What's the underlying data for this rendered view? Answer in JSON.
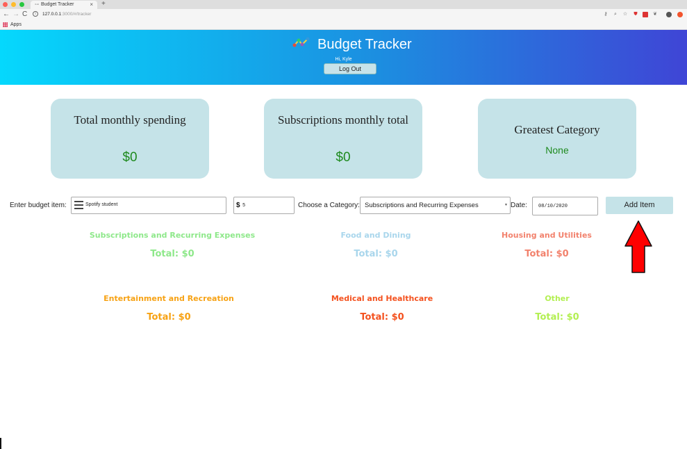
{
  "browser": {
    "tab_title": "Budget Tracker",
    "tab_close": "×",
    "new_tab": "+",
    "url_host": "127.0.0.1",
    "url_path": ":3000/#/tracker",
    "bookmarks_apps": "Apps"
  },
  "header": {
    "title": "Budget Tracker",
    "greeting": "Hi, Kyle",
    "logout_label": "Log Out"
  },
  "cards": [
    {
      "title": "Total monthly spending",
      "value": "$0"
    },
    {
      "title": "Subscriptions monthly total",
      "value": "$0"
    },
    {
      "title": "Greatest Category",
      "value": "None"
    }
  ],
  "form": {
    "item_label": "Enter budget item:",
    "item_value": "Spotify student",
    "amount_sign": "$",
    "amount_value": "5",
    "category_label": "Choose a Category:",
    "category_value": "Subscriptions and Recurring Expenses",
    "date_label": "Date:",
    "date_value": "08/10/2020",
    "add_label": "Add Item"
  },
  "categories": [
    {
      "name": "Subscriptions and Recurring Expenses",
      "total": "Total: $0",
      "color": "#8ee88a"
    },
    {
      "name": "Food and Dining",
      "total": "Total: $0",
      "color": "#a9d6ec"
    },
    {
      "name": "Housing and Utilities",
      "total": "Total: $0",
      "color": "#f2826d"
    },
    {
      "name": "Entertainment and Recreation",
      "total": "Total: $0",
      "color": "#f7a214"
    },
    {
      "name": "Medical and Healthcare",
      "total": "Total: $0",
      "color": "#f4511e"
    },
    {
      "name": "Other",
      "total": "Total: $0",
      "color": "#b3ef52"
    }
  ],
  "colors": {
    "header_gradient_start": "#05d8fd",
    "header_gradient_end": "#3f45d6",
    "card_bg": "#c5e3e8",
    "money_green": "#1e8a1e",
    "arrow_red": "#ff0000"
  },
  "icons": [
    "logo-icon",
    "spreadsheet-icon",
    "arrow-up-icon"
  ]
}
